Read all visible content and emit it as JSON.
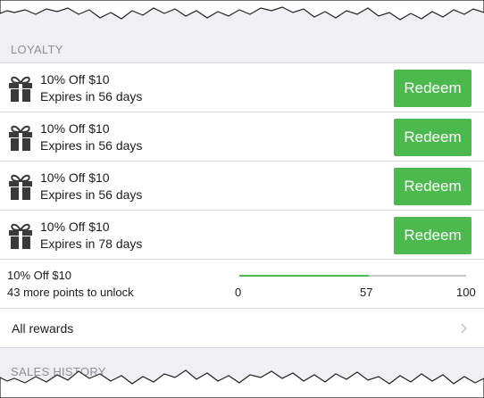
{
  "loyalty": {
    "section_title": "LOYALTY",
    "rewards": [
      {
        "title": "10% Off $10",
        "expiry": "Expires in 56 days",
        "icon": "gift-icon",
        "button_label": "Redeem"
      },
      {
        "title": "10% Off $10",
        "expiry": "Expires in 56 days",
        "icon": "gift-icon",
        "button_label": "Redeem"
      },
      {
        "title": "10% Off $10",
        "expiry": "Expires in 56 days",
        "icon": "gift-icon",
        "button_label": "Redeem"
      },
      {
        "title": "10% Off $10",
        "expiry": "Expires in 78 days",
        "icon": "gift-icon",
        "button_label": "Redeem"
      }
    ],
    "progress": {
      "title": "10% Off $10",
      "subtitle": "43 more points to unlock",
      "min_label": "0",
      "current_label": "57",
      "max_label": "100",
      "current": 57,
      "max": 100
    },
    "all_rewards_label": "All rewards"
  },
  "next_section_title": "SALES HISTORY",
  "colors": {
    "accent_green": "#4cb94f",
    "background": "#efeff4",
    "header_text": "#8e8e93"
  }
}
